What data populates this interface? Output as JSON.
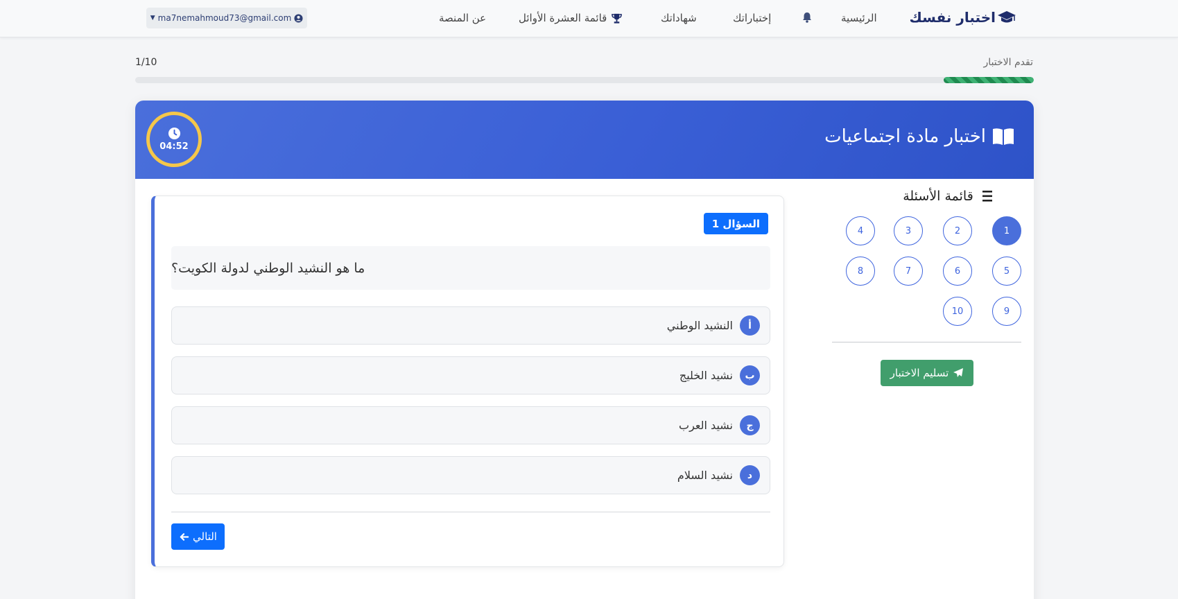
{
  "navbar": {
    "brand": "اختبار نفسك",
    "links": {
      "home": "الرئيسية",
      "exams": "إختباراتك",
      "certificates": "شهاداتك",
      "leaderboard": "قائمة العشرة الأوائل",
      "about": "عن المنصة"
    },
    "user_email": "ma7nemahmoud73@gmail.com"
  },
  "progress": {
    "label": "تقدم الاختبار",
    "count": "1/10",
    "value": 0.1
  },
  "exam": {
    "title": "اختبار مادة اجتماعيات",
    "timer": "04:52"
  },
  "sidebar": {
    "title": "قائمة الأسئلة",
    "questions": [
      "1",
      "2",
      "3",
      "4",
      "5",
      "6",
      "7",
      "8",
      "9",
      "10"
    ],
    "active_question": "1",
    "submit_label": "تسليم الاختبار"
  },
  "question": {
    "badge": "السؤال 1",
    "text": "ما هو النشيد الوطني لدولة الكويت؟",
    "options": [
      {
        "letter": "أ",
        "text": "النشيد الوطني"
      },
      {
        "letter": "ب",
        "text": "نشيد الخليج"
      },
      {
        "letter": "ج",
        "text": "نشيد العرب"
      },
      {
        "letter": "د",
        "text": "نشيد السلام"
      }
    ],
    "next_label": "التالي"
  },
  "colors": {
    "primary": "#0d6efd",
    "header": "#3a5fd6",
    "success": "#419e6c",
    "timer_ring": "#f5c74a",
    "brand": "#1f2d6b"
  },
  "icons": {
    "brand": "graduation-cap-icon",
    "bell": "bell-icon",
    "trophy": "trophy-icon",
    "user": "user-circle-icon",
    "exam": "open-book-icon",
    "timer": "clock-icon",
    "list": "list-ordered-icon",
    "submit": "paper-plane-icon",
    "next": "arrow-left-icon"
  }
}
